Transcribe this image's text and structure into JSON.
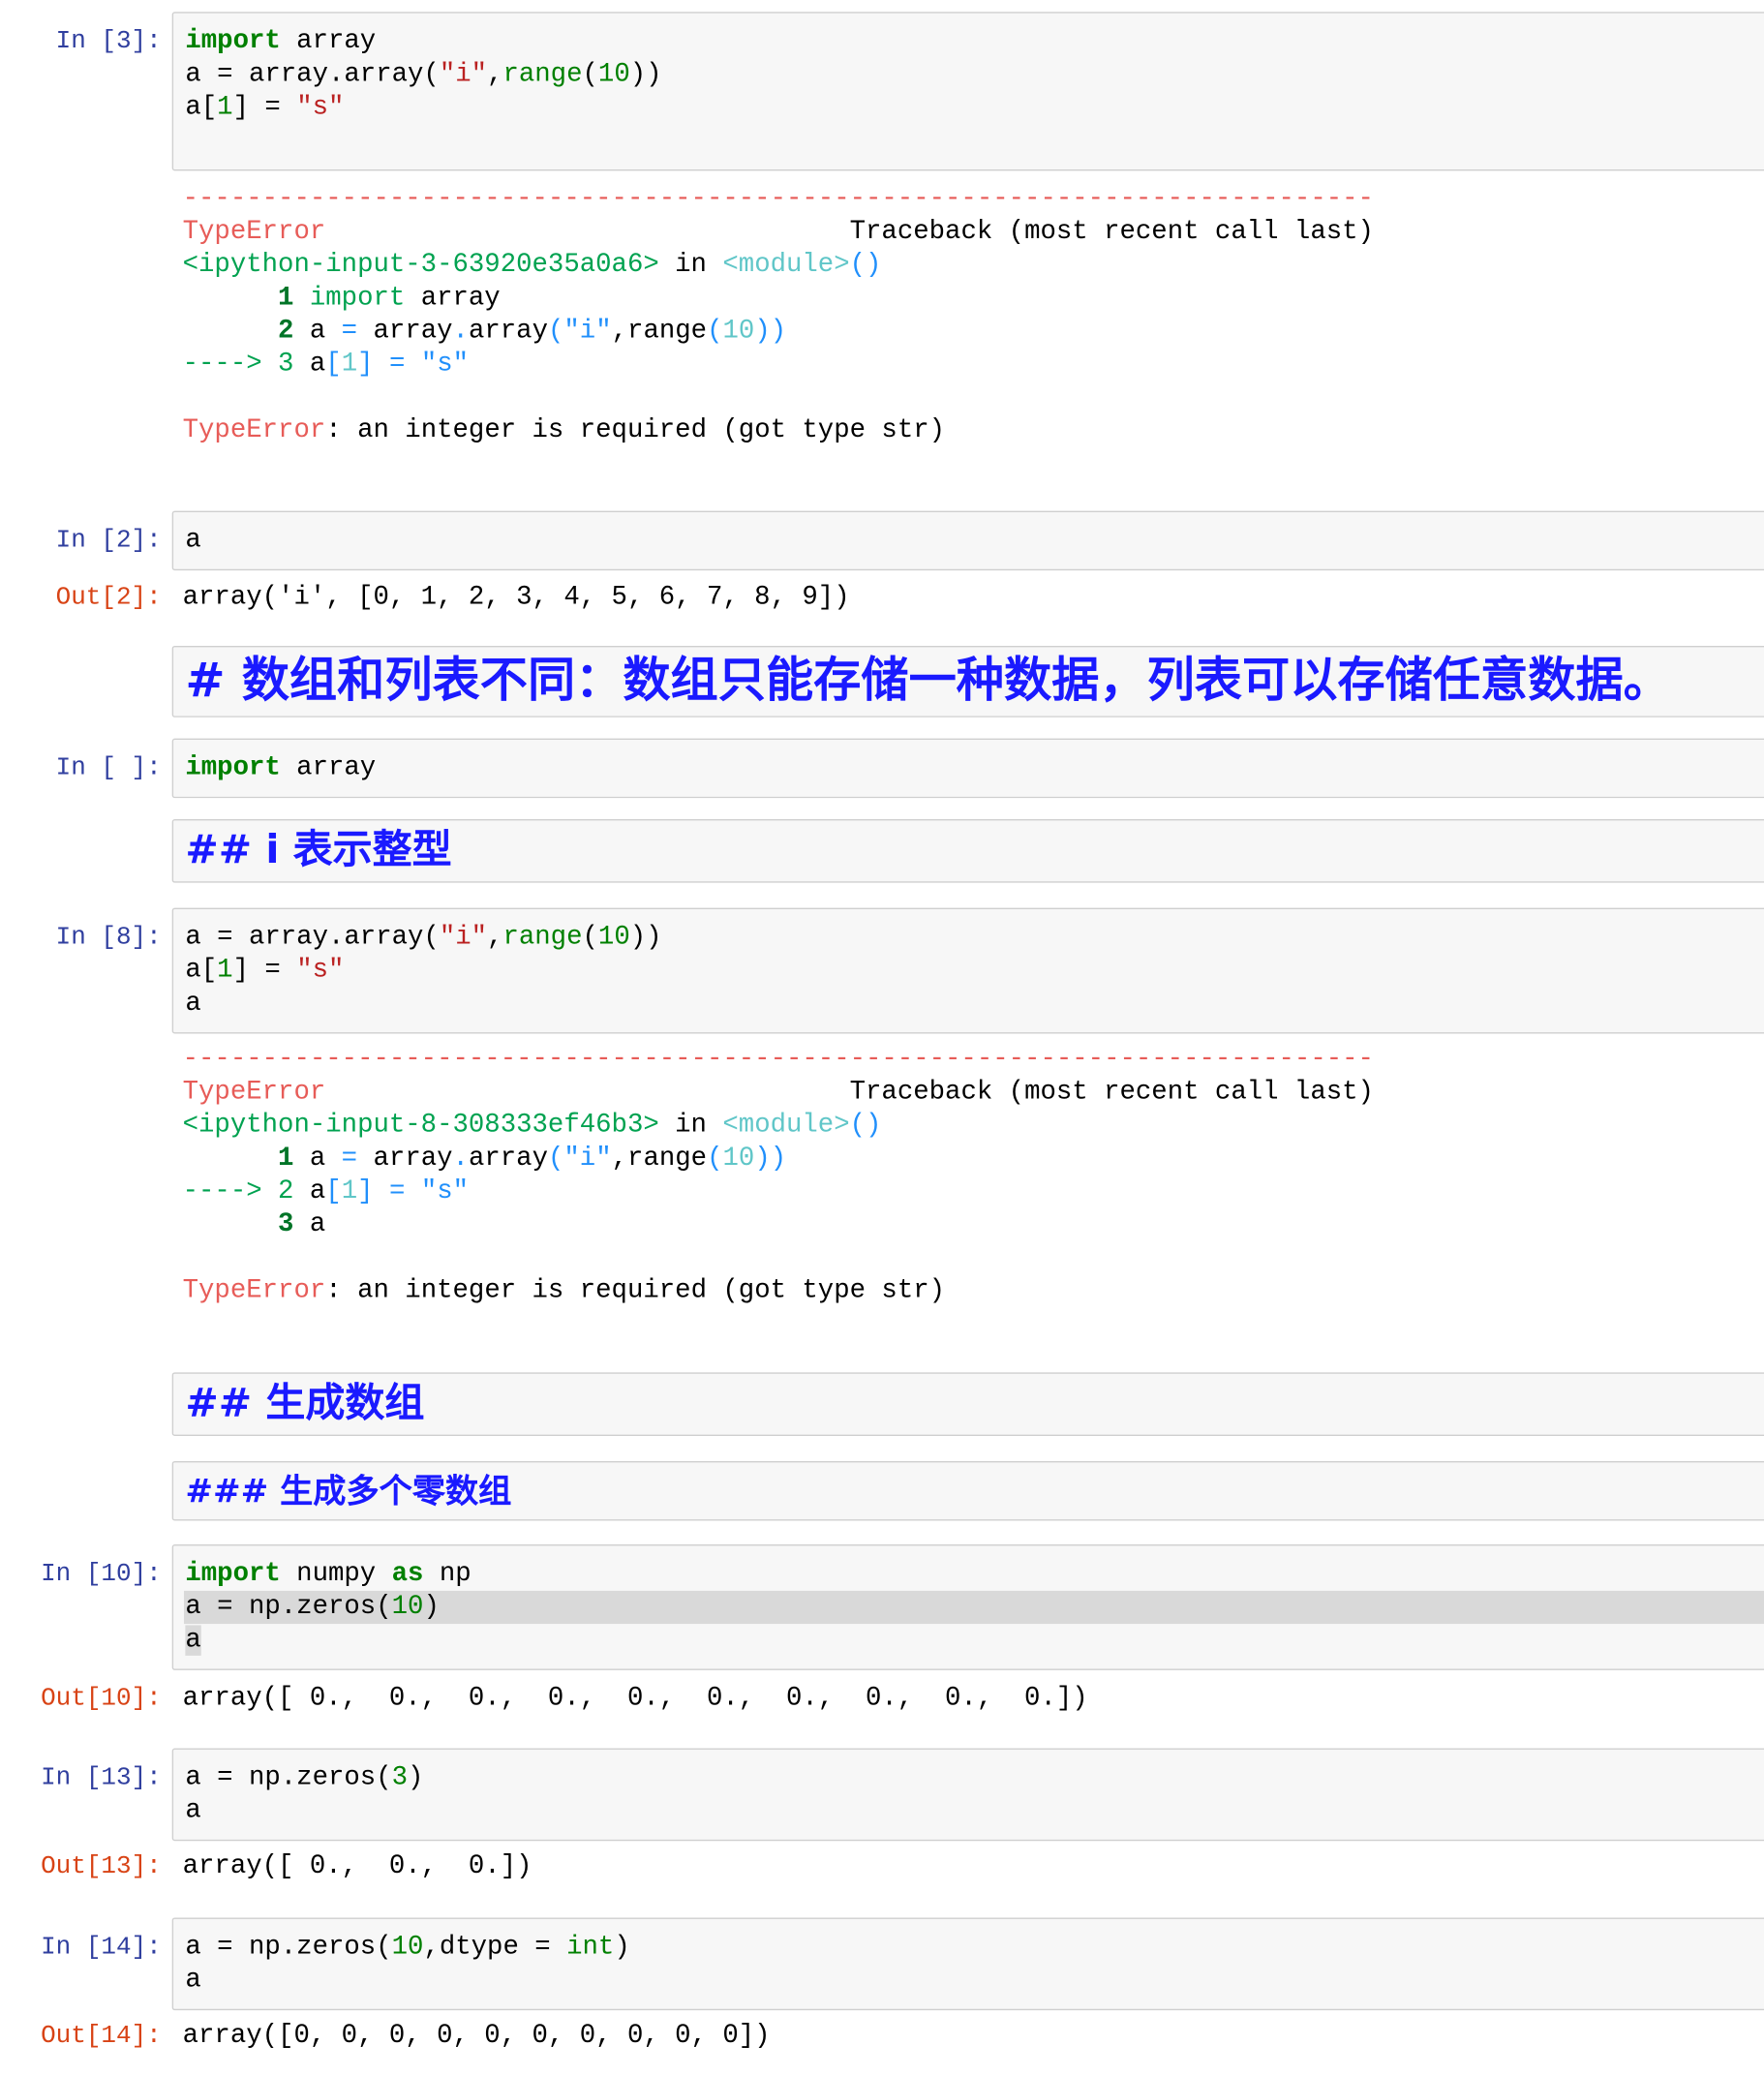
{
  "cells": [
    {
      "kind": "code",
      "prompt": "In [3]:",
      "lines": [
        [
          [
            "import",
            "kw"
          ],
          [
            " array",
            ""
          ]
        ],
        [
          [
            "a = array.array(",
            ""
          ],
          [
            "\"i\"",
            "str"
          ],
          [
            ",",
            ""
          ],
          [
            "range",
            "bi"
          ],
          [
            "(",
            ""
          ],
          [
            "10",
            "num"
          ],
          [
            "))",
            ""
          ]
        ],
        [
          [
            "a[",
            ""
          ],
          [
            "1",
            "num"
          ],
          [
            "] = ",
            ""
          ],
          [
            "\"s\"",
            "str"
          ]
        ],
        [
          [
            " ",
            ""
          ]
        ]
      ]
    },
    {
      "kind": "error",
      "lines": [
        [
          [
            "---------------------------------------------------------------------------",
            "ered"
          ]
        ],
        [
          [
            "TypeError",
            "ered"
          ],
          [
            "                                 Traceback (most recent call last)",
            ""
          ]
        ],
        [
          [
            "<ipython-input-3-63920e35a0a6>",
            "egrn"
          ],
          [
            " in ",
            ""
          ],
          [
            "<module>",
            "ecyn"
          ],
          [
            "()",
            "eblu"
          ]
        ],
        [
          [
            "      1 ",
            "egrnb"
          ],
          [
            "import",
            "egrn"
          ],
          [
            " array",
            ""
          ]
        ],
        [
          [
            "      2 ",
            "egrnb"
          ],
          [
            "a ",
            ""
          ],
          [
            "=",
            "eblu"
          ],
          [
            " array",
            ""
          ],
          [
            ".",
            "eblu"
          ],
          [
            "array",
            ""
          ],
          [
            "(",
            "eblu"
          ],
          [
            "\"i\"",
            "eblu"
          ],
          [
            ",",
            ""
          ],
          [
            "range",
            ""
          ],
          [
            "(",
            "eblu"
          ],
          [
            "10",
            "ecyn"
          ],
          [
            "))",
            "eblu"
          ]
        ],
        [
          [
            "----> 3 ",
            "egrn"
          ],
          [
            "a",
            ""
          ],
          [
            "[",
            "eblu"
          ],
          [
            "1",
            "ecyn"
          ],
          [
            "]",
            "eblu"
          ],
          [
            " ",
            ""
          ],
          [
            "=",
            "eblu"
          ],
          [
            " ",
            ""
          ],
          [
            "\"s\"",
            "eblu"
          ]
        ],
        [
          [
            " ",
            ""
          ]
        ],
        [
          [
            "TypeError",
            "ered"
          ],
          [
            ": an integer is required (got type str)",
            ""
          ]
        ]
      ]
    },
    {
      "kind": "code",
      "prompt": "In [2]:",
      "lines": [
        [
          [
            "a",
            ""
          ]
        ]
      ]
    },
    {
      "kind": "output",
      "prompt": "Out[2]:",
      "lines": [
        [
          [
            "array('i', [0, 1, 2, 3, 4, 5, 6, 7, 8, 9])",
            ""
          ]
        ]
      ]
    },
    {
      "kind": "markdown",
      "level": "h1",
      "text": "# 数组和列表不同：数组只能存储一种数据，列表可以存储任意数据。"
    },
    {
      "kind": "code",
      "prompt": "In [ ]:",
      "lines": [
        [
          [
            "import",
            "kw"
          ],
          [
            " array",
            ""
          ]
        ]
      ]
    },
    {
      "kind": "markdown",
      "level": "h2",
      "text": "## i 表示整型"
    },
    {
      "kind": "code",
      "prompt": "In [8]:",
      "lines": [
        [
          [
            "a = array.array(",
            ""
          ],
          [
            "\"i\"",
            "str"
          ],
          [
            ",",
            ""
          ],
          [
            "range",
            "bi"
          ],
          [
            "(",
            ""
          ],
          [
            "10",
            "num"
          ],
          [
            "))",
            ""
          ]
        ],
        [
          [
            "a[",
            ""
          ],
          [
            "1",
            "num"
          ],
          [
            "] = ",
            ""
          ],
          [
            "\"s\"",
            "str"
          ]
        ],
        [
          [
            "a",
            ""
          ]
        ]
      ]
    },
    {
      "kind": "error",
      "lines": [
        [
          [
            "---------------------------------------------------------------------------",
            "ered"
          ]
        ],
        [
          [
            "TypeError",
            "ered"
          ],
          [
            "                                 Traceback (most recent call last)",
            ""
          ]
        ],
        [
          [
            "<ipython-input-8-308333ef46b3>",
            "egrn"
          ],
          [
            " in ",
            ""
          ],
          [
            "<module>",
            "ecyn"
          ],
          [
            "()",
            "eblu"
          ]
        ],
        [
          [
            "      1 ",
            "egrnb"
          ],
          [
            "a ",
            ""
          ],
          [
            "=",
            "eblu"
          ],
          [
            " array",
            ""
          ],
          [
            ".",
            "eblu"
          ],
          [
            "array",
            ""
          ],
          [
            "(",
            "eblu"
          ],
          [
            "\"i\"",
            "eblu"
          ],
          [
            ",",
            ""
          ],
          [
            "range",
            ""
          ],
          [
            "(",
            "eblu"
          ],
          [
            "10",
            "ecyn"
          ],
          [
            "))",
            "eblu"
          ]
        ],
        [
          [
            "----> 2 ",
            "egrn"
          ],
          [
            "a",
            ""
          ],
          [
            "[",
            "eblu"
          ],
          [
            "1",
            "ecyn"
          ],
          [
            "]",
            "eblu"
          ],
          [
            " ",
            ""
          ],
          [
            "=",
            "eblu"
          ],
          [
            " ",
            ""
          ],
          [
            "\"s\"",
            "eblu"
          ]
        ],
        [
          [
            "      3 ",
            "egrnb"
          ],
          [
            "a",
            ""
          ]
        ],
        [
          [
            " ",
            ""
          ]
        ],
        [
          [
            "TypeError",
            "ered"
          ],
          [
            ": an integer is required (got type str)",
            ""
          ]
        ]
      ]
    },
    {
      "kind": "markdown",
      "level": "h2",
      "text": "## 生成数组"
    },
    {
      "kind": "markdown",
      "level": "h3",
      "text": "### 生成多个零数组"
    },
    {
      "kind": "code",
      "prompt": "In [10]:",
      "lines": [
        [
          [
            "import",
            "kw"
          ],
          [
            " numpy ",
            ""
          ],
          [
            "as",
            "kw"
          ],
          [
            " np",
            ""
          ]
        ],
        [
          [
            "a = np.zeros(",
            ""
          ],
          [
            "10",
            "num"
          ],
          [
            ")",
            ""
          ]
        ],
        [
          [
            "a",
            "cur"
          ]
        ]
      ],
      "highlight_line": 1
    },
    {
      "kind": "output",
      "prompt": "Out[10]:",
      "lines": [
        [
          [
            "array([ 0.,  0.,  0.,  0.,  0.,  0.,  0.,  0.,  0.,  0.])",
            ""
          ]
        ]
      ]
    },
    {
      "kind": "code",
      "prompt": "In [13]:",
      "lines": [
        [
          [
            "a = np.zeros(",
            ""
          ],
          [
            "3",
            "num"
          ],
          [
            ")",
            ""
          ]
        ],
        [
          [
            "a",
            ""
          ]
        ]
      ]
    },
    {
      "kind": "output",
      "prompt": "Out[13]:",
      "lines": [
        [
          [
            "array([ 0.,  0.,  0.])",
            ""
          ]
        ]
      ]
    },
    {
      "kind": "code",
      "prompt": "In [14]:",
      "lines": [
        [
          [
            "a = np.zeros(",
            ""
          ],
          [
            "10",
            "num"
          ],
          [
            ",dtype = ",
            ""
          ],
          [
            "int",
            "bi"
          ],
          [
            ")",
            ""
          ]
        ],
        [
          [
            "a",
            ""
          ]
        ]
      ]
    },
    {
      "kind": "output",
      "prompt": "Out[14]:",
      "lines": [
        [
          [
            "array([0, 0, 0, 0, 0, 0, 0, 0, 0, 0])",
            ""
          ]
        ]
      ]
    }
  ]
}
